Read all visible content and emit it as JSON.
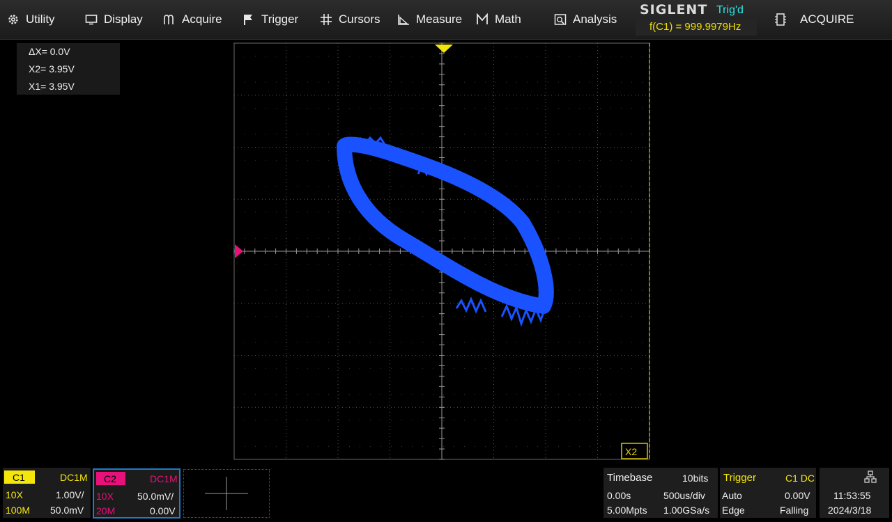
{
  "menu": [
    {
      "label": "Utility",
      "icon": "gear-icon"
    },
    {
      "label": "Display",
      "icon": "monitor-icon"
    },
    {
      "label": "Acquire",
      "icon": "acquire-icon"
    },
    {
      "label": "Trigger",
      "icon": "trigger-flag-icon"
    },
    {
      "label": "Cursors",
      "icon": "cursors-icon"
    },
    {
      "label": "Measure",
      "icon": "measure-icon"
    },
    {
      "label": "Math",
      "icon": "math-icon"
    },
    {
      "label": "Analysis",
      "icon": "analysis-icon"
    }
  ],
  "header": {
    "brand": "SIGLENT",
    "trigger_status": "Trig'd",
    "frequency": "f(C1) = 999.9979Hz",
    "mode": "ACQUIRE",
    "mode_icon": "memory-icon"
  },
  "cursors": {
    "delta_x": "ΔX= 0.0V",
    "x2": "X2= 3.95V",
    "x1": "X1= 3.95V",
    "x2_tag": "X2"
  },
  "channels": {
    "c1": {
      "name": "C1",
      "coupling": "DC1M",
      "probe": "10X",
      "scale": "1.00V/",
      "bw": "100M",
      "offset": "50.0mV",
      "color": "#f5e60a"
    },
    "c2": {
      "name": "C2",
      "coupling": "DC1M",
      "probe": "10X",
      "scale": "50.0mV/",
      "bw": "20M",
      "offset": "0.00V",
      "color": "#e8107a"
    }
  },
  "timebase": {
    "title": "Timebase",
    "bits": "10bits",
    "delay": "0.00s",
    "scale": "500us/div",
    "points": "5.00Mpts",
    "rate": "1.00GSa/s"
  },
  "trigger": {
    "title": "Trigger",
    "source": "C1 DC",
    "mode": "Auto",
    "level": "0.00V",
    "type": "Edge",
    "slope": "Falling"
  },
  "clock": {
    "time": "11:53:55",
    "date": "2024/3/18",
    "network_icon": "network-icon"
  },
  "colors": {
    "trace": "#1a52ff",
    "grid": "#7a7a7a",
    "cursor": "#e8d400",
    "c1": "#f5e60a",
    "c2": "#e8107a"
  }
}
